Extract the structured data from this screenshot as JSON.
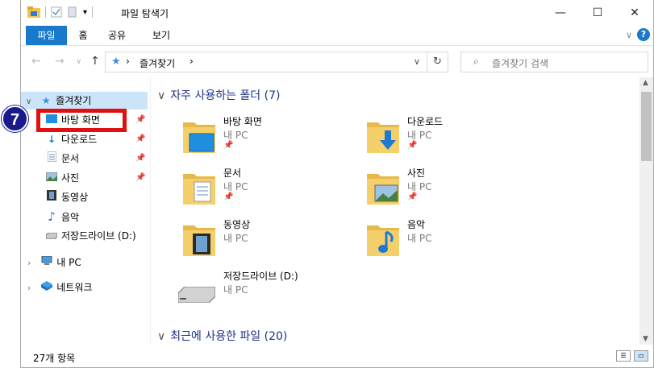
{
  "window": {
    "title": "파일 탐색기",
    "minimize_icon": "—",
    "maximize_icon": "☐",
    "close_icon": "✕"
  },
  "ribbon": {
    "tabs": [
      "파일",
      "홈",
      "공유",
      "보기"
    ],
    "expand_icon": "∨",
    "help_label": "?"
  },
  "address": {
    "back": "←",
    "forward": "→",
    "recent": "∨",
    "up": "↑",
    "breadcrumb": "즐겨찾기",
    "refresh": "↻",
    "search_placeholder": "즐겨찾기 검색"
  },
  "nav": {
    "items": [
      {
        "label": "즐겨찾기",
        "icon": "star-icon"
      },
      {
        "label": "바탕 화면",
        "icon": "desktop-icon"
      },
      {
        "label": "다운로드",
        "icon": "download-icon"
      },
      {
        "label": "문서",
        "icon": "document-icon"
      },
      {
        "label": "사진",
        "icon": "picture-icon"
      },
      {
        "label": "동영상",
        "icon": "video-icon"
      },
      {
        "label": "음악",
        "icon": "music-icon"
      },
      {
        "label": "저장드라이브 (D:)",
        "icon": "drive-icon"
      },
      {
        "label": "내 PC",
        "icon": "pc-icon"
      },
      {
        "label": "네트워크",
        "icon": "network-icon"
      }
    ]
  },
  "content": {
    "frequent_header": "자주 사용하는 폴더 (7)",
    "recent_header": "최근에 사용한 파일 (20)",
    "folders": [
      {
        "name": "바탕 화면",
        "location": "내 PC",
        "pinned": true
      },
      {
        "name": "다운로드",
        "location": "내 PC",
        "pinned": true
      },
      {
        "name": "문서",
        "location": "내 PC",
        "pinned": true
      },
      {
        "name": "사진",
        "location": "내 PC",
        "pinned": true
      },
      {
        "name": "동영상",
        "location": "내 PC",
        "pinned": false
      },
      {
        "name": "음악",
        "location": "내 PC",
        "pinned": false
      },
      {
        "name": "저장드라이브 (D:)",
        "location": "내 PC",
        "pinned": false
      }
    ]
  },
  "status": {
    "count": "27개 항목"
  },
  "annotation": {
    "step": "7"
  },
  "colors": {
    "accent": "#1979ca",
    "selection": "#cce4f7",
    "highlight_box": "#e01010",
    "badge": "#1a1a8c"
  }
}
